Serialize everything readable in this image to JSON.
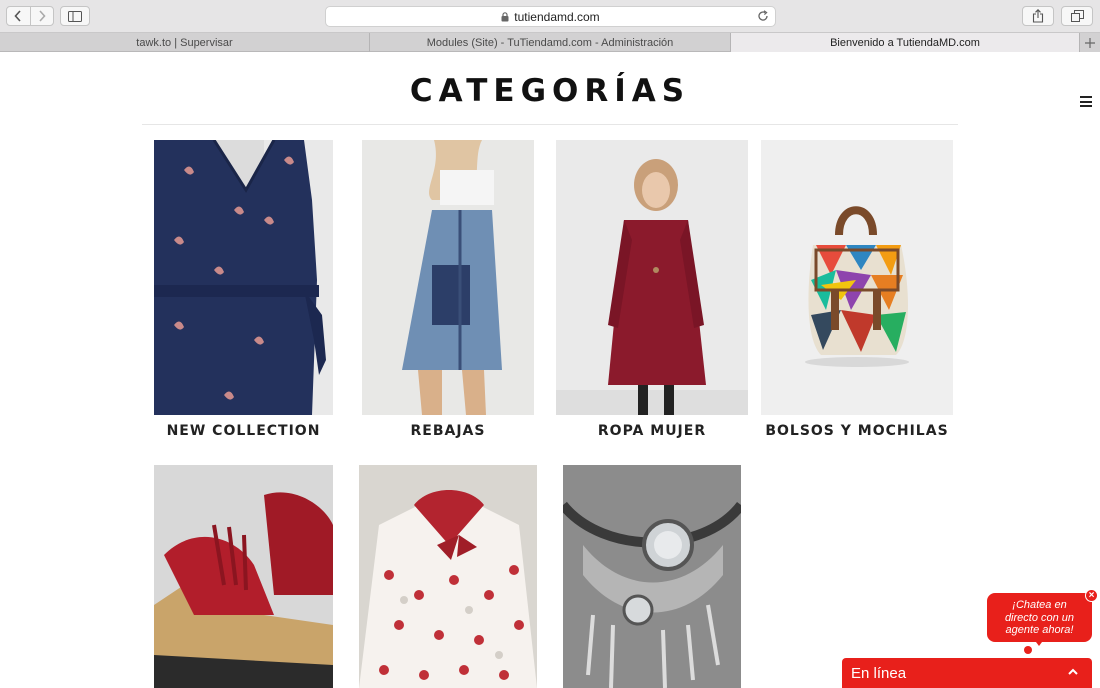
{
  "browser": {
    "url": "tutiendamd.com",
    "tabs": [
      {
        "label": "tawk.to | Supervisar"
      },
      {
        "label": "Modules (Site) - TuTiendamd.com - Administración"
      },
      {
        "label": "Bienvenido a TutiendaMD.com"
      }
    ]
  },
  "page": {
    "title": "CATEGORÍAS"
  },
  "categories": [
    {
      "label": "NEW COLLECTION",
      "image": "navy-printed-dress-photo"
    },
    {
      "label": "REBAJAS",
      "image": "denim-pinafore-dress-photo"
    },
    {
      "label": "ROPA MUJER",
      "image": "burgundy-dress-photo"
    },
    {
      "label": "BOLSOS Y MOCHILAS",
      "image": "geometric-backpack-photo"
    },
    {
      "label": "",
      "image": "red-sandals-photo"
    },
    {
      "label": "",
      "image": "polka-dot-girls-dress-photo"
    },
    {
      "label": "",
      "image": "statement-necklace-photo"
    }
  ],
  "chat": {
    "prompt_line1": "¡Chatea en",
    "prompt_line2": "directo con un",
    "prompt_line3": "agente ahora!",
    "status": "En línea",
    "color": "#e8201b"
  }
}
